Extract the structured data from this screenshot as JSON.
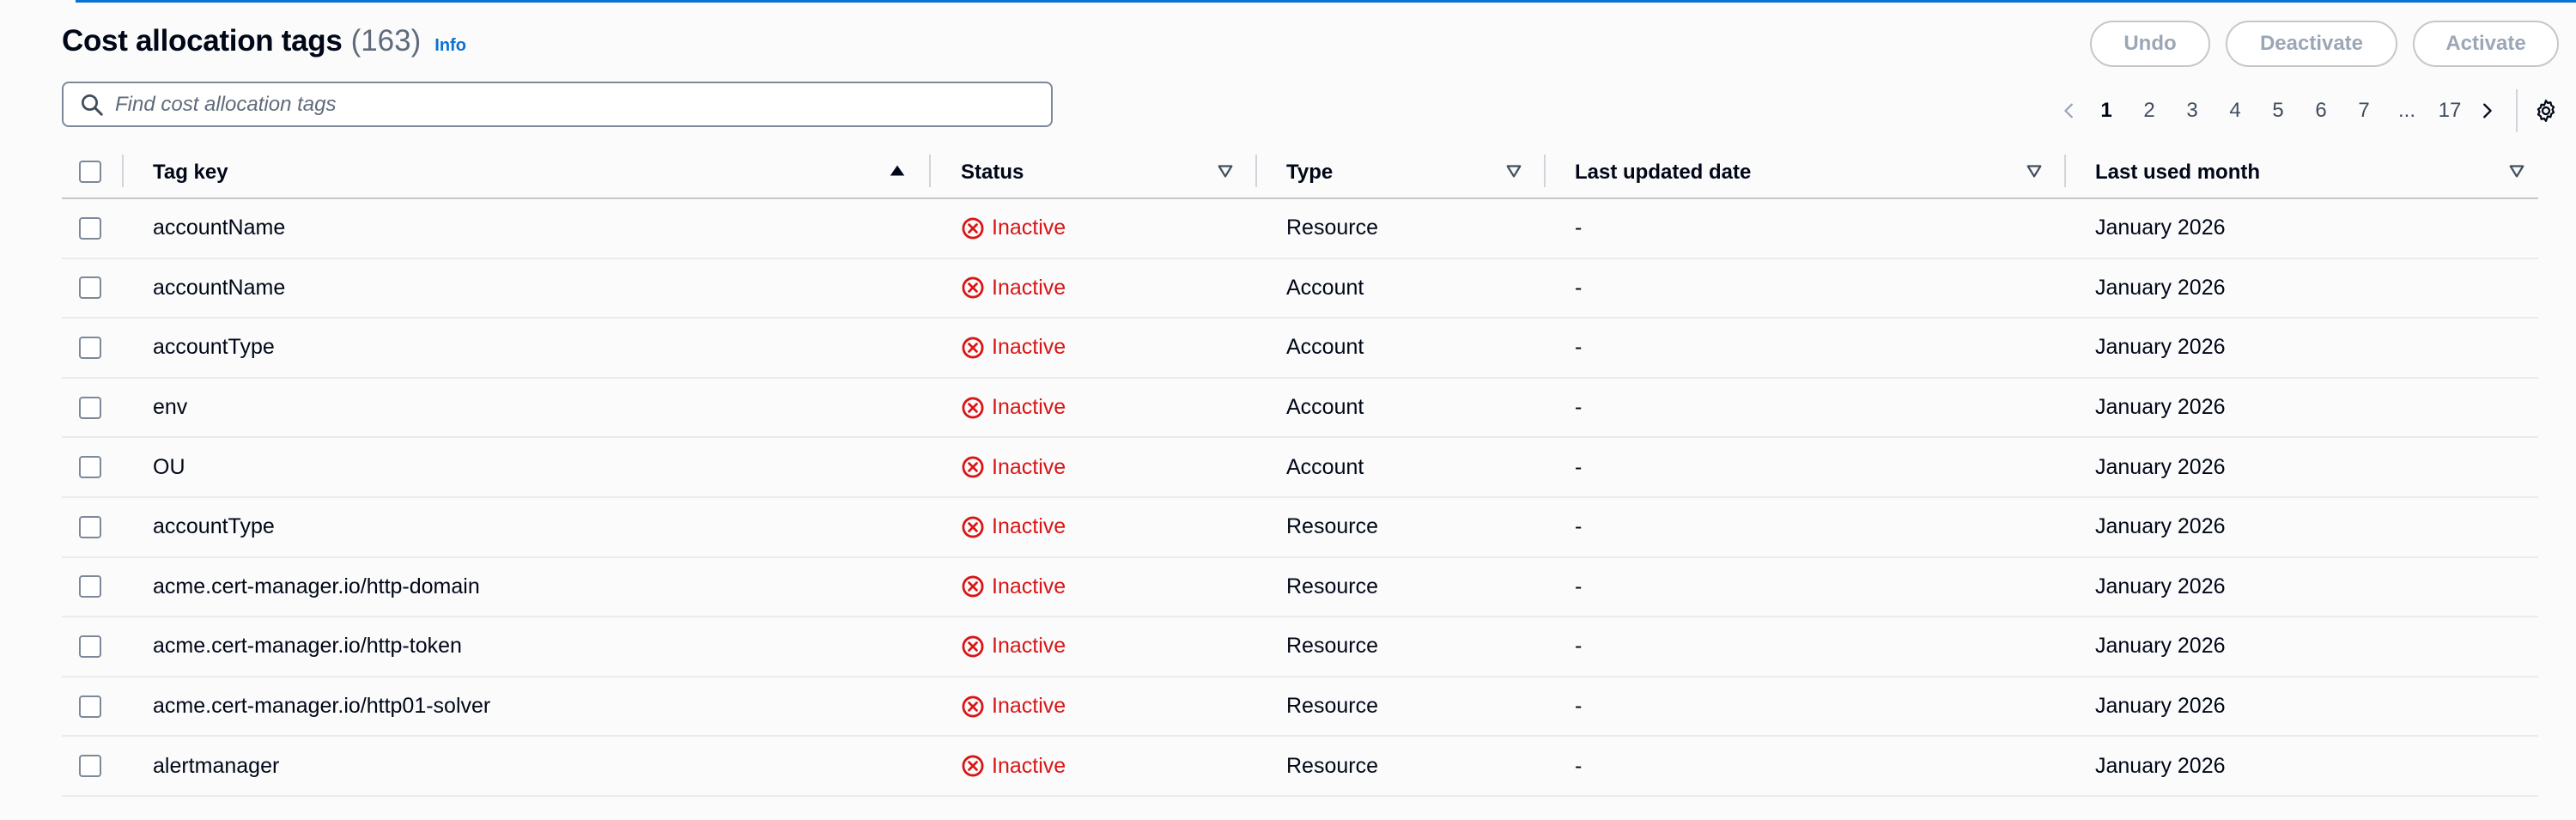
{
  "header": {
    "title": "Cost allocation tags",
    "count": "(163)",
    "info": "Info"
  },
  "actions": {
    "undo": "Undo",
    "deactivate": "Deactivate",
    "activate": "Activate"
  },
  "search": {
    "placeholder": "Find cost allocation tags",
    "value": ""
  },
  "pagination": {
    "pages": [
      "1",
      "2",
      "3",
      "4",
      "5",
      "6",
      "7",
      "...",
      "17"
    ],
    "current": "1"
  },
  "table": {
    "columns": {
      "tag_key": "Tag key",
      "status": "Status",
      "type": "Type",
      "last_updated": "Last updated date",
      "last_used": "Last used month"
    },
    "rows": [
      {
        "tag_key": "accountName",
        "status": "Inactive",
        "type": "Resource",
        "last_updated": "-",
        "last_used": "January 2026"
      },
      {
        "tag_key": "accountName",
        "status": "Inactive",
        "type": "Account",
        "last_updated": "-",
        "last_used": "January 2026"
      },
      {
        "tag_key": "accountType",
        "status": "Inactive",
        "type": "Account",
        "last_updated": "-",
        "last_used": "January 2026"
      },
      {
        "tag_key": "env",
        "status": "Inactive",
        "type": "Account",
        "last_updated": "-",
        "last_used": "January 2026"
      },
      {
        "tag_key": "OU",
        "status": "Inactive",
        "type": "Account",
        "last_updated": "-",
        "last_used": "January 2026"
      },
      {
        "tag_key": "accountType",
        "status": "Inactive",
        "type": "Resource",
        "last_updated": "-",
        "last_used": "January 2026"
      },
      {
        "tag_key": "acme.cert-manager.io/http-domain",
        "status": "Inactive",
        "type": "Resource",
        "last_updated": "-",
        "last_used": "January 2026"
      },
      {
        "tag_key": "acme.cert-manager.io/http-token",
        "status": "Inactive",
        "type": "Resource",
        "last_updated": "-",
        "last_used": "January 2026"
      },
      {
        "tag_key": "acme.cert-manager.io/http01-solver",
        "status": "Inactive",
        "type": "Resource",
        "last_updated": "-",
        "last_used": "January 2026"
      },
      {
        "tag_key": "alertmanager",
        "status": "Inactive",
        "type": "Resource",
        "last_updated": "-",
        "last_used": "January 2026"
      }
    ]
  },
  "colors": {
    "accent": "#0972d3",
    "inactive": "#d91515",
    "text": "#000716",
    "muted": "#5f6b7a"
  }
}
